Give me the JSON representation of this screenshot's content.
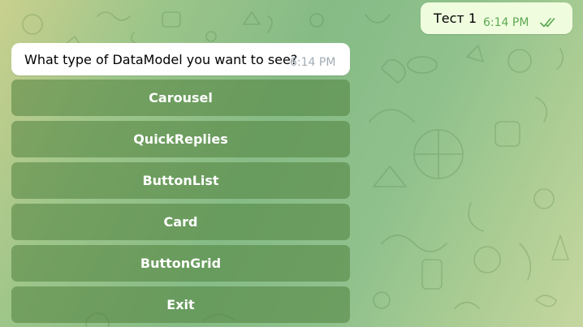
{
  "messages": {
    "outgoing": {
      "text": "Тест 1",
      "time": "6:14 PM",
      "status": "read"
    },
    "incoming": {
      "text": "What type of DataModel you want to see?",
      "time": "6:14 PM"
    }
  },
  "keyboard": {
    "buttons": [
      {
        "label": "Carousel"
      },
      {
        "label": "QuickReplies"
      },
      {
        "label": "ButtonList"
      },
      {
        "label": "Card"
      },
      {
        "label": "ButtonGrid"
      },
      {
        "label": "Exit"
      }
    ]
  },
  "colors": {
    "outgoing_bubble": "#effdde",
    "incoming_bubble": "#ffffff",
    "read_check": "#5ca853",
    "button_overlay": "rgba(78,126,58,0.53)"
  },
  "icons": {
    "read_status": "double-check-icon"
  }
}
